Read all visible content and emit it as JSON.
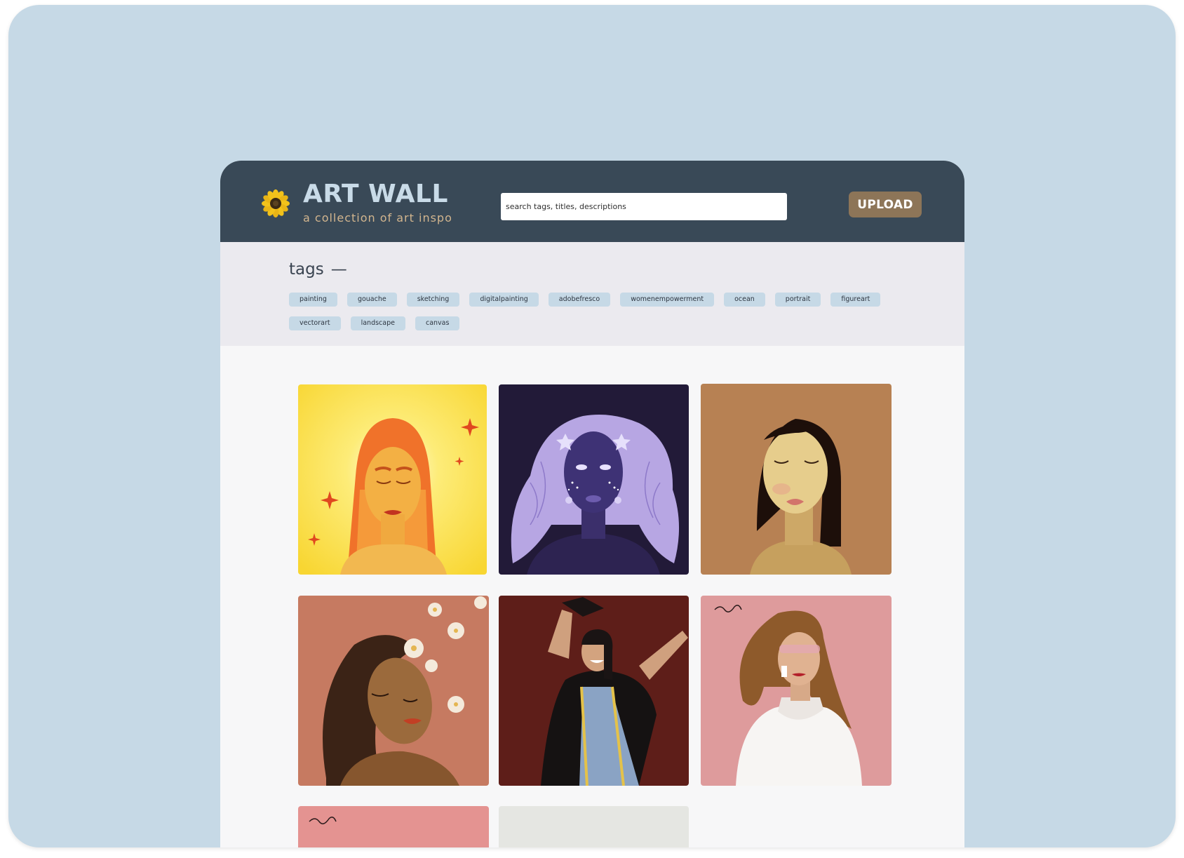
{
  "header": {
    "title": "ART WALL",
    "subtitle": "a collection of art inspo",
    "search_placeholder": "search tags, titles, descriptions",
    "upload_label": "UPLOAD",
    "logo_icon": "sunflower-icon"
  },
  "tags": {
    "heading": "tags",
    "collapse_symbol": "—",
    "items": [
      "painting",
      "gouache",
      "sketching",
      "digitalpainting",
      "adobefresco",
      "womenempowerment",
      "ocean",
      "portrait",
      "figureart",
      "vectorart",
      "landscape",
      "canvas"
    ]
  },
  "colors": {
    "frame_bg": "#c6d9e6",
    "header_bg": "#394957",
    "title": "#c9dbe8",
    "subtitle": "#d2b58e",
    "upload_bg": "#8d7558",
    "tag_bg": "#c6d9e6",
    "tags_section_bg": "#ebeaef",
    "gallery_bg": "#f7f7f8"
  },
  "gallery": {
    "artworks": [
      {
        "icon": "sunburst-portrait-artwork",
        "background": "#fbe25a"
      },
      {
        "icon": "starry-lavender-hair-portrait-artwork",
        "background": "#221a38"
      },
      {
        "icon": "closed-eyes-portrait-artwork",
        "background": "#b78153"
      },
      {
        "icon": "flowers-in-hair-portrait-artwork",
        "background": "#c67a61"
      },
      {
        "icon": "graduation-portrait-artwork",
        "background": "#5e1e19"
      },
      {
        "icon": "white-sweater-portrait-artwork",
        "background": "#de9b9c"
      },
      {
        "icon": "pink-portrait-artwork",
        "background": "#e49391"
      },
      {
        "icon": "grey-artwork",
        "background": "#e5e6e2"
      }
    ]
  }
}
